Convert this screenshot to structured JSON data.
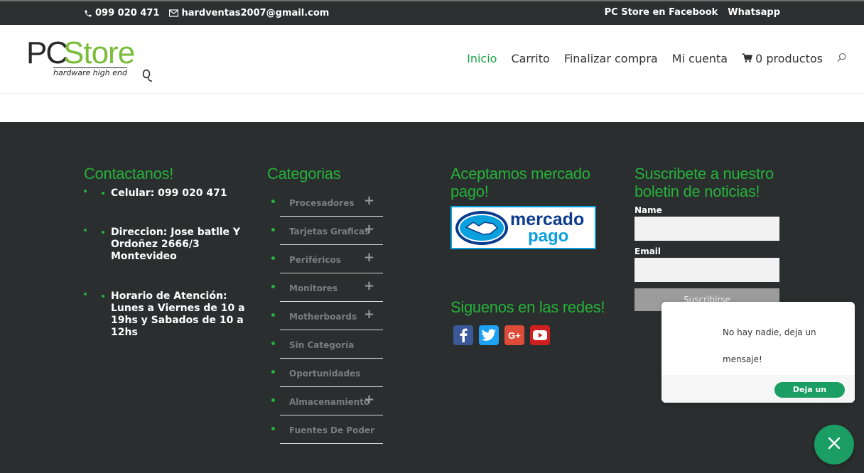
{
  "topbar": {
    "phone": "099 020 471",
    "email": "hardventas2007@gmail.com",
    "facebook_link": "PC Store en Facebook",
    "whatsapp_link": "Whatsapp"
  },
  "logo": {
    "pc": "PC",
    "store": "Store",
    "tagline": "hardware high end"
  },
  "nav": {
    "items": [
      "Inicio",
      "Carrito",
      "Finalizar compra",
      "Mi cuenta"
    ],
    "cart_label": "0 productos"
  },
  "footer": {
    "contact": {
      "title": "Contactanos!",
      "items": [
        "Celular: 099 020 471",
        "Direccion: Jose batlle Y Ordoñez 2666/3 Montevideo",
        "Horario de Atención: Lunes a Viernes de 10 a 19hs y Sabados de 10 a 12hs"
      ]
    },
    "categories": {
      "title": "Categorias",
      "items": [
        {
          "label": "Procesadores",
          "expandable": true
        },
        {
          "label": "Tarjetas Graficas",
          "expandable": true
        },
        {
          "label": "Periféricos",
          "expandable": true
        },
        {
          "label": "Monitores",
          "expandable": true
        },
        {
          "label": "Motherboards",
          "expandable": true
        },
        {
          "label": "Sin Categoría",
          "expandable": false
        },
        {
          "label": "Oportunidades",
          "expandable": false
        },
        {
          "label": "Almacenamiento",
          "expandable": true
        },
        {
          "label": "Fuentes De Poder",
          "expandable": false
        }
      ]
    },
    "payments": {
      "title": "Aceptamos mercado pago!",
      "badge_line1": "mercado",
      "badge_line2": "pago"
    },
    "socials": {
      "title": "Siguenos en las redes!",
      "icons": [
        "facebook-icon",
        "twitter-icon",
        "google-plus-icon",
        "youtube-icon"
      ],
      "gplus_text": "G+"
    },
    "newsletter": {
      "title": "Suscribete a nuestro boletin de noticias!",
      "name_label": "Name",
      "email_label": "Email",
      "button_label": "Suscribirse"
    }
  },
  "chat": {
    "message": "No hay nadie, deja un mensaje!",
    "button_label": "Deja un mensaje"
  },
  "colors": {
    "accent_green": "#25b13b",
    "nav_active": "#1aa34a",
    "chat_green": "#1a9e63",
    "footer_bg": "#2b2e2e",
    "topbar_bg": "#2c2f2f"
  }
}
